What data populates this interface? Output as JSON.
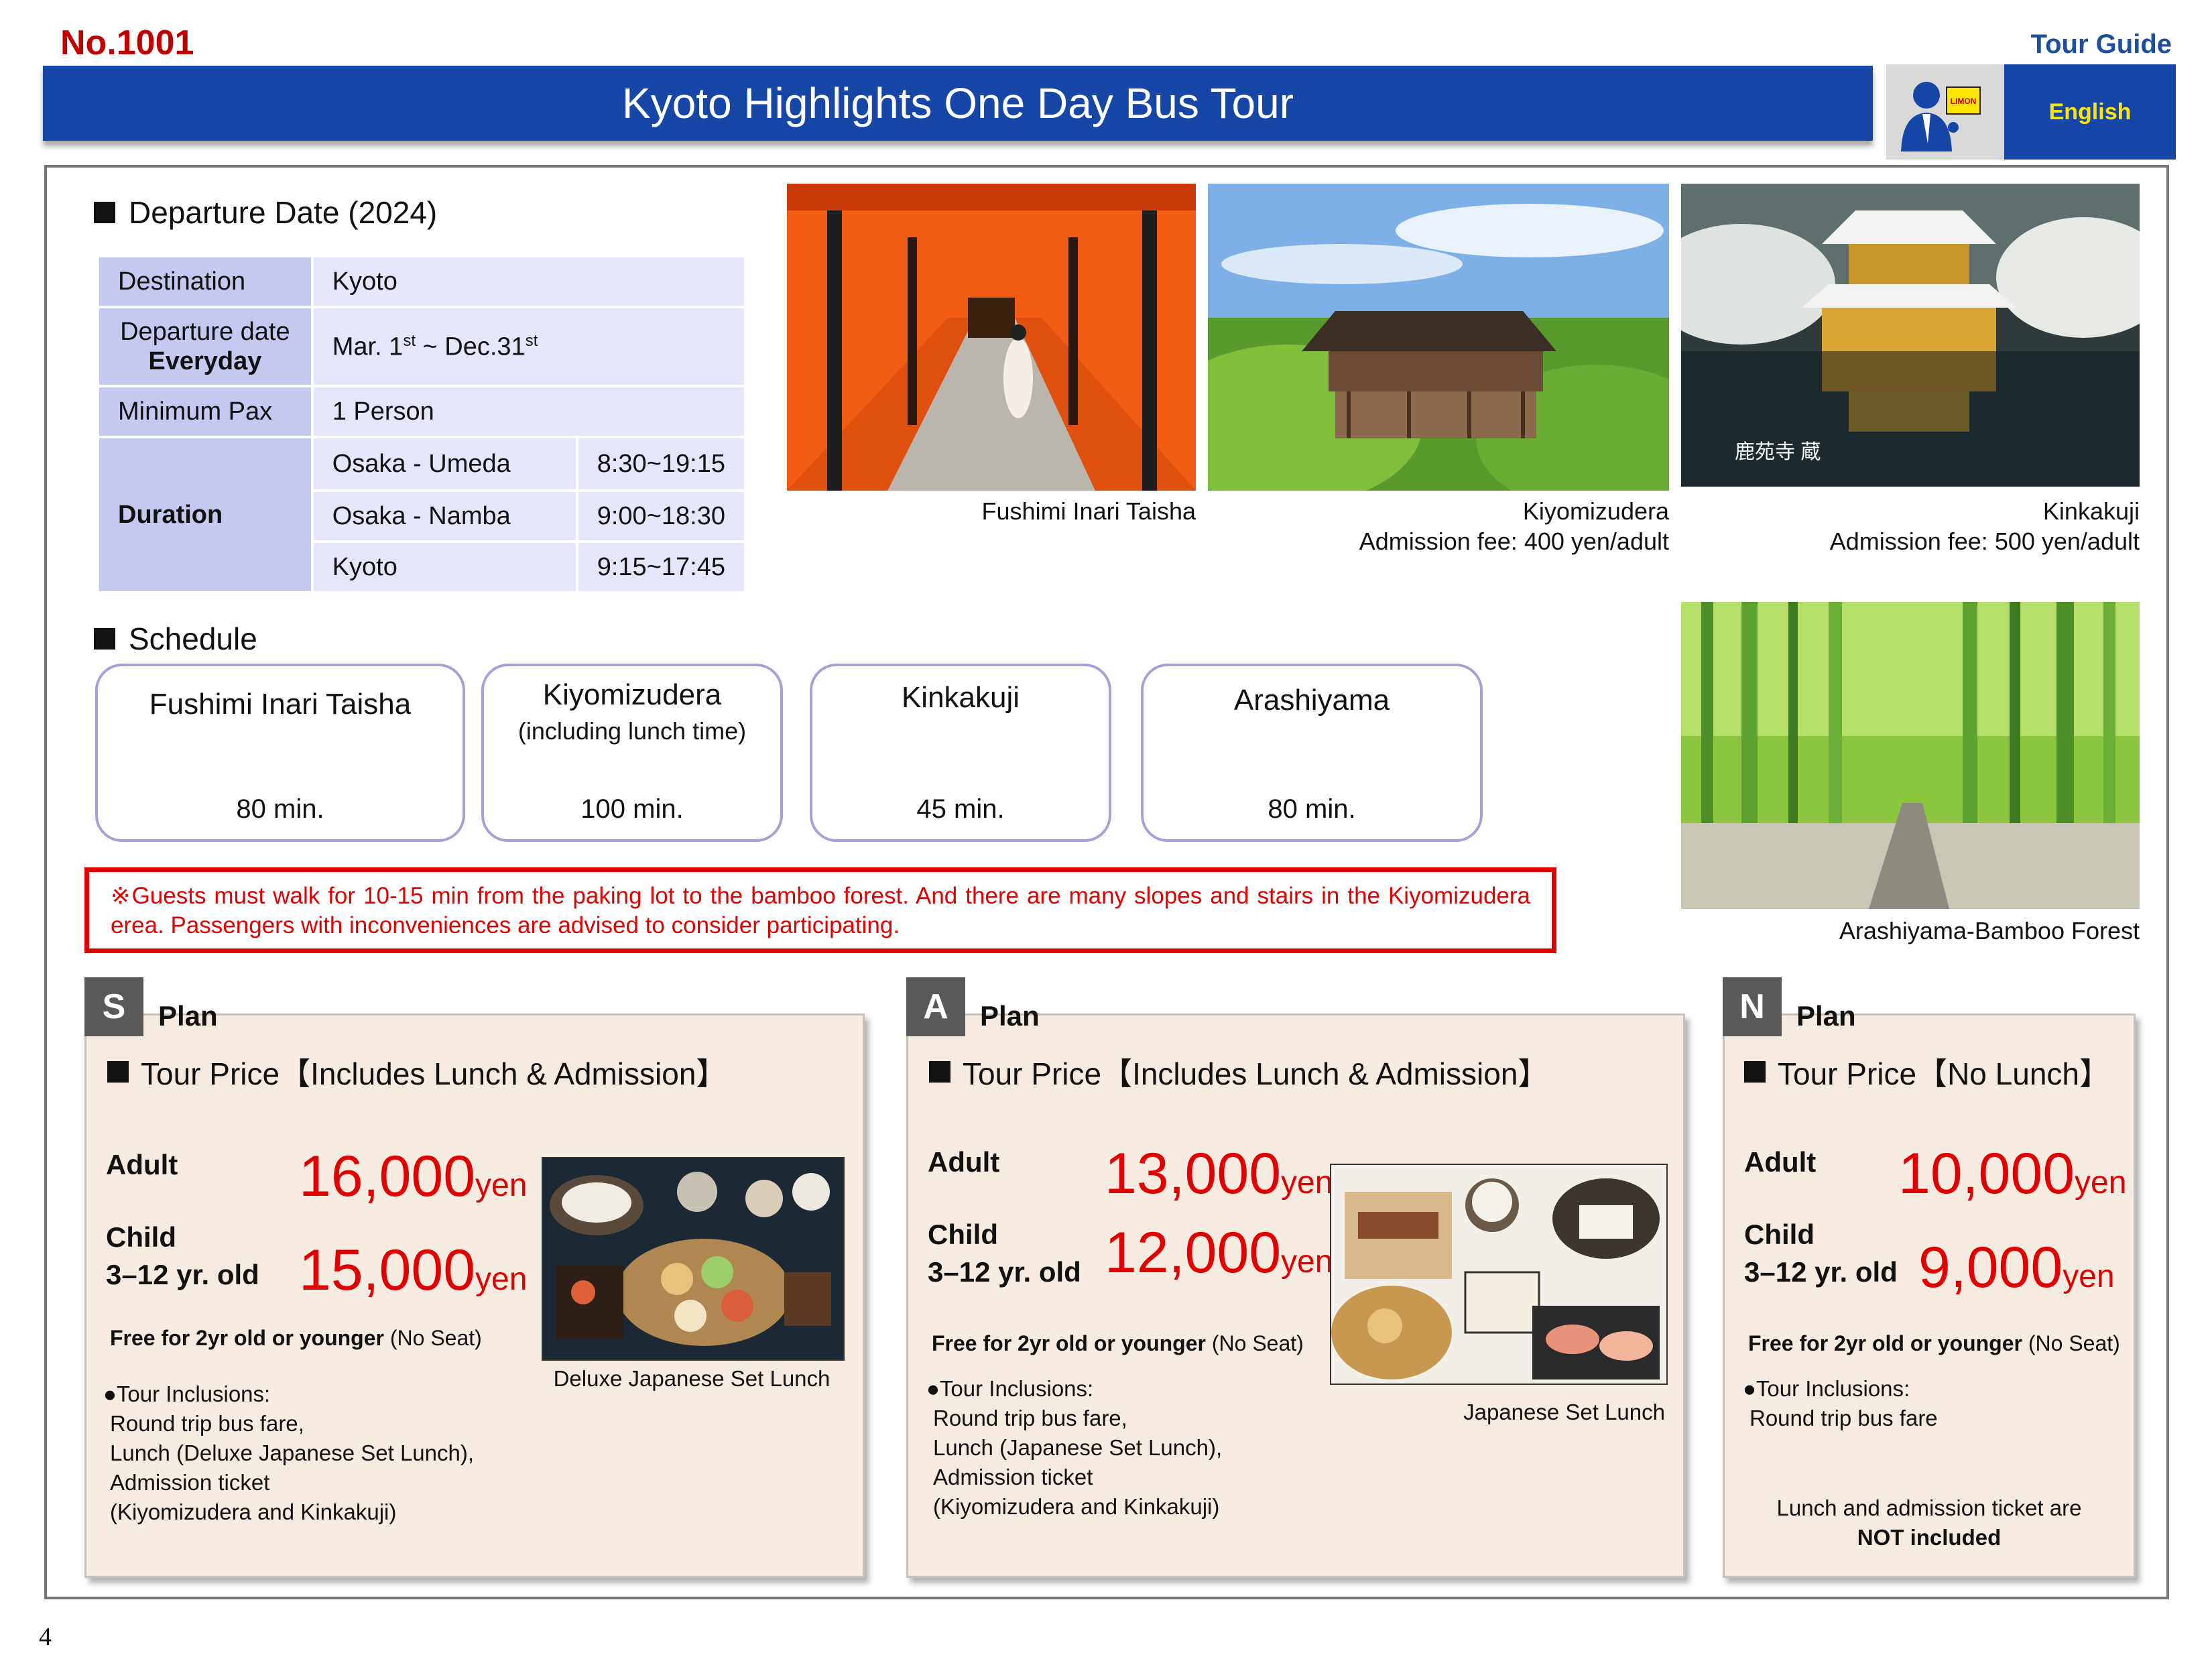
{
  "header": {
    "tour_no": "No.1001",
    "guide_label": "Tour Guide",
    "title": "Kyoto Highlights One Day Bus Tour",
    "language": "English",
    "badge_logo": "LIMON"
  },
  "departure": {
    "heading": "Departure Date (2024)",
    "rows": {
      "destination_label": "Destination",
      "destination_value": "Kyoto",
      "date_label_1": "Departure date",
      "date_label_2": "Everyday",
      "date_start": "Mar. 1",
      "date_start_sup": "st",
      "date_sep": " ~ Dec.31",
      "date_end_sup": "st",
      "pax_label": "Minimum Pax",
      "pax_value": "1 Person",
      "duration_label": "Duration"
    },
    "durations": [
      {
        "place": "Osaka - Umeda",
        "time": "8:30~19:15"
      },
      {
        "place": "Osaka - Namba",
        "time": "9:00~18:30"
      },
      {
        "place": "Kyoto",
        "time": "9:15~17:45"
      }
    ]
  },
  "photos": {
    "fushimi": "Fushimi Inari Taisha",
    "kiyomizu": "Kiyomizudera",
    "kiyomizu_fee": "Admission fee: 400 yen/adult",
    "kinkaku": "Kinkakuji",
    "kinkaku_fee": "Admission fee: 500 yen/adult",
    "kinkaku_stamp": "鹿苑寺 蔵",
    "bamboo": "Arashiyama-Bamboo Forest"
  },
  "schedule": {
    "heading": "Schedule",
    "items": [
      {
        "name": "Fushimi Inari Taisha",
        "sub": "",
        "minutes": "80 min."
      },
      {
        "name": "Kiyomizudera",
        "sub": "(including lunch time)",
        "minutes": "100 min."
      },
      {
        "name": "Kinkakuji",
        "sub": "",
        "minutes": "45 min."
      },
      {
        "name": "Arashiyama",
        "sub": "",
        "minutes": "80 min."
      }
    ]
  },
  "warning": "※Guests must walk for 10-15 min from the paking lot to the bamboo forest. And there are many slopes and stairs in the Kiyomizudera erea. Passengers with inconveniences are advised to consider participating.",
  "plans": [
    {
      "letter": "S",
      "word": "Plan",
      "heading": "Tour Price【Includes Lunch & Admission】",
      "adult_label": "Adult",
      "adult_price": "16,000",
      "unit": "yen",
      "child_label": "Child",
      "child_age": "3–12 yr. old",
      "child_price": "15,000",
      "free_bold": "Free for 2yr old or younger",
      "free_rest": " (No Seat)",
      "incl_title": "●Tour Inclusions:",
      "incl_lines": [
        "Round trip bus fare,",
        "Lunch (Deluxe Japanese Set Lunch),",
        "Admission ticket",
        "(Kiyomizudera and Kinkakuji)"
      ],
      "photo_caption": "Deluxe Japanese Set Lunch"
    },
    {
      "letter": "A",
      "word": "Plan",
      "heading": "Tour Price【Includes Lunch & Admission】",
      "adult_label": "Adult",
      "adult_price": "13,000",
      "unit": "yen",
      "child_label": "Child",
      "child_age": "3–12 yr. old",
      "child_price": "12,000",
      "free_bold": "Free for 2yr old or younger",
      "free_rest": " (No Seat)",
      "incl_title": "●Tour Inclusions:",
      "incl_lines": [
        "Round trip bus fare,",
        "Lunch (Japanese Set Lunch),",
        "Admission ticket",
        "(Kiyomizudera and Kinkakuji)"
      ],
      "photo_caption": "Japanese Set Lunch"
    },
    {
      "letter": "N",
      "word": "Plan",
      "heading": "Tour Price【No Lunch】",
      "adult_label": "Adult",
      "adult_price": "10,000",
      "unit": "yen",
      "child_label": "Child",
      "child_age": "3–12 yr. old",
      "child_price": "9,000",
      "free_bold": "Free for 2yr old or younger",
      "free_rest": " (No Seat)",
      "incl_title": "●Tour Inclusions:",
      "incl_lines": [
        "Round trip bus fare"
      ],
      "not_included_1": "Lunch and admission ticket are",
      "not_included_2": "NOT included"
    }
  ],
  "page_number": "4"
}
